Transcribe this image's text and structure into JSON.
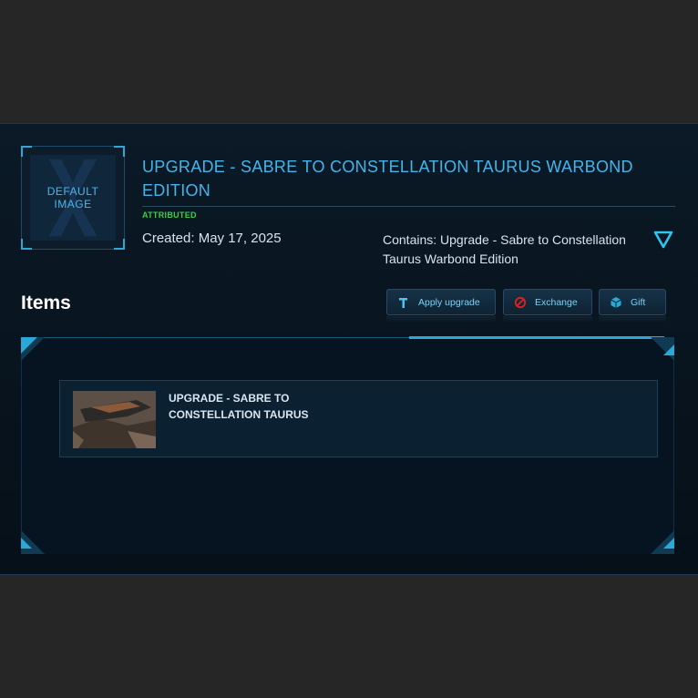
{
  "pledge": {
    "title": "UPGRADE - SABRE TO CONSTELLATION TAURUS WARBOND EDITION",
    "badge": "ATTRIBUTED",
    "created": "Created: May 17, 2025",
    "contains": "Contains: Upgrade - Sabre to Constellation Taurus Warbond Edition",
    "thumbnail": {
      "line1": "DEFAULT",
      "line2": "IMAGE"
    }
  },
  "items_section": {
    "heading": "Items",
    "buttons": [
      {
        "label": "Apply upgrade",
        "icon": "hammer-icon"
      },
      {
        "label": "Exchange",
        "icon": "cancel-icon"
      },
      {
        "label": "Gift",
        "icon": "gift-cube-icon"
      }
    ],
    "list": [
      {
        "title": "UPGRADE - SABRE TO CONSTELLATION TAURUS"
      }
    ]
  },
  "colors": {
    "accent": "#2aa8d8",
    "title": "#45b4ea",
    "badge": "#3ad04a",
    "exchange_icon": "#e02020"
  }
}
